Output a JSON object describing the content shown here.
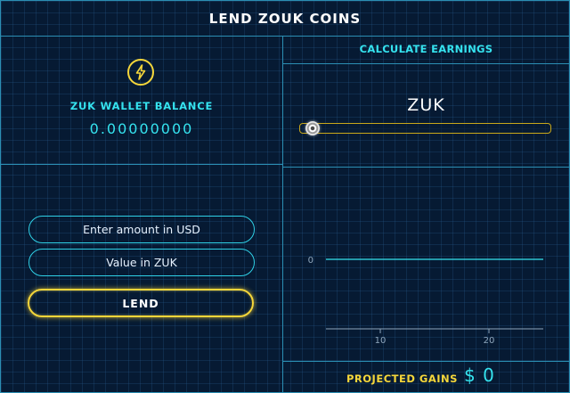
{
  "header": {
    "title": "LEND ZOUK COINS"
  },
  "wallet": {
    "icon": "lightning-bolt-icon",
    "label": "ZUK WALLET BALANCE",
    "balance": "0.00000000"
  },
  "lend_form": {
    "usd_input": {
      "value": "",
      "placeholder": "Enter amount in USD"
    },
    "zuk_input": {
      "value": "",
      "placeholder": "Value in ZUK"
    },
    "lend_button": "LEND"
  },
  "calculator": {
    "title": "CALCULATE EARNINGS",
    "currency_label": "ZUK",
    "slider_value": 0
  },
  "chart_data": {
    "type": "line",
    "series": [
      {
        "x": [
          5,
          25
        ],
        "y": [
          0,
          0
        ]
      }
    ],
    "x_ticks": [
      10,
      20
    ],
    "y_ticks": [
      0
    ],
    "xlim": [
      5,
      25
    ],
    "grid": false
  },
  "projected": {
    "label": "PROJECTED GAINS",
    "value": "$ 0"
  },
  "colors": {
    "background": "#061a33",
    "border": "#2b8fb3",
    "cyan_accent": "#35e3ef",
    "gold_accent": "#f5d63a",
    "text": "#ffffff"
  }
}
